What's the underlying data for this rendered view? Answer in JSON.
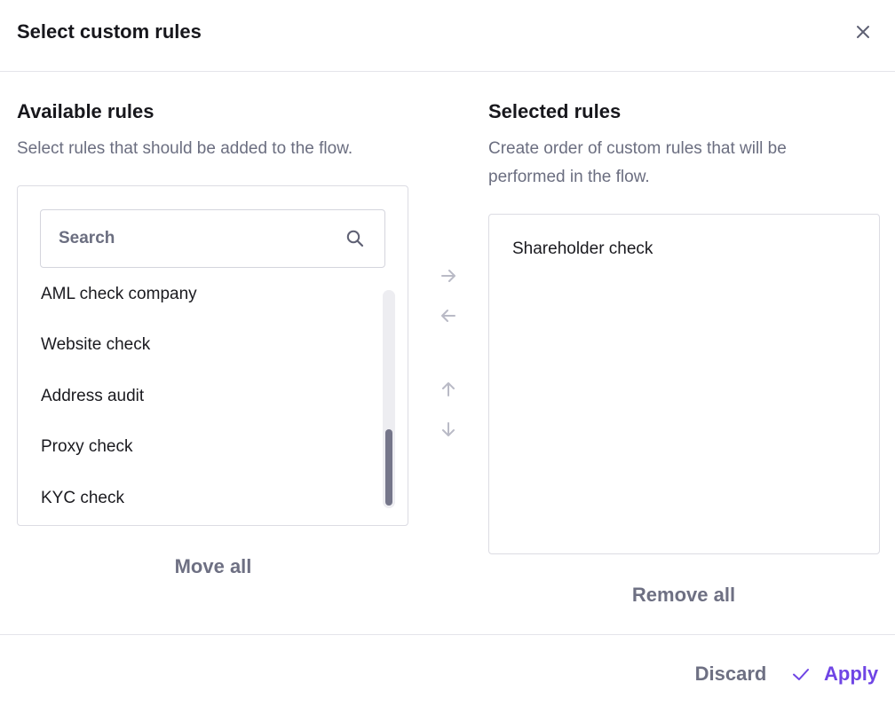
{
  "dialog": {
    "title": "Select custom rules",
    "close_icon": "close-icon"
  },
  "available": {
    "title": "Available rules",
    "description": "Select rules that should be added to the flow.",
    "search_placeholder": "Search",
    "search_icon": "search-icon",
    "items": [
      {
        "label": "AML check company"
      },
      {
        "label": "Website check"
      },
      {
        "label": "Address audit"
      },
      {
        "label": "Proxy check"
      },
      {
        "label": "KYC check"
      }
    ],
    "scroll_position": 1.0,
    "move_all_label": "Move all"
  },
  "controls": {
    "move_right_icon": "arrow-right-icon",
    "move_left_icon": "arrow-left-icon",
    "move_up_icon": "arrow-up-icon",
    "move_down_icon": "arrow-down-icon"
  },
  "selected": {
    "title": "Selected rules",
    "description": "Create order of custom rules that will be performed in the flow.",
    "items": [
      {
        "label": "Shareholder check"
      }
    ],
    "remove_all_label": "Remove all"
  },
  "footer": {
    "discard_label": "Discard",
    "apply_label": "Apply",
    "apply_icon": "check-icon"
  },
  "colors": {
    "accent": "#6f45e5",
    "muted_text": "#6b6e80",
    "border": "#dcdce3",
    "disabled_icon": "#b9bac6"
  }
}
